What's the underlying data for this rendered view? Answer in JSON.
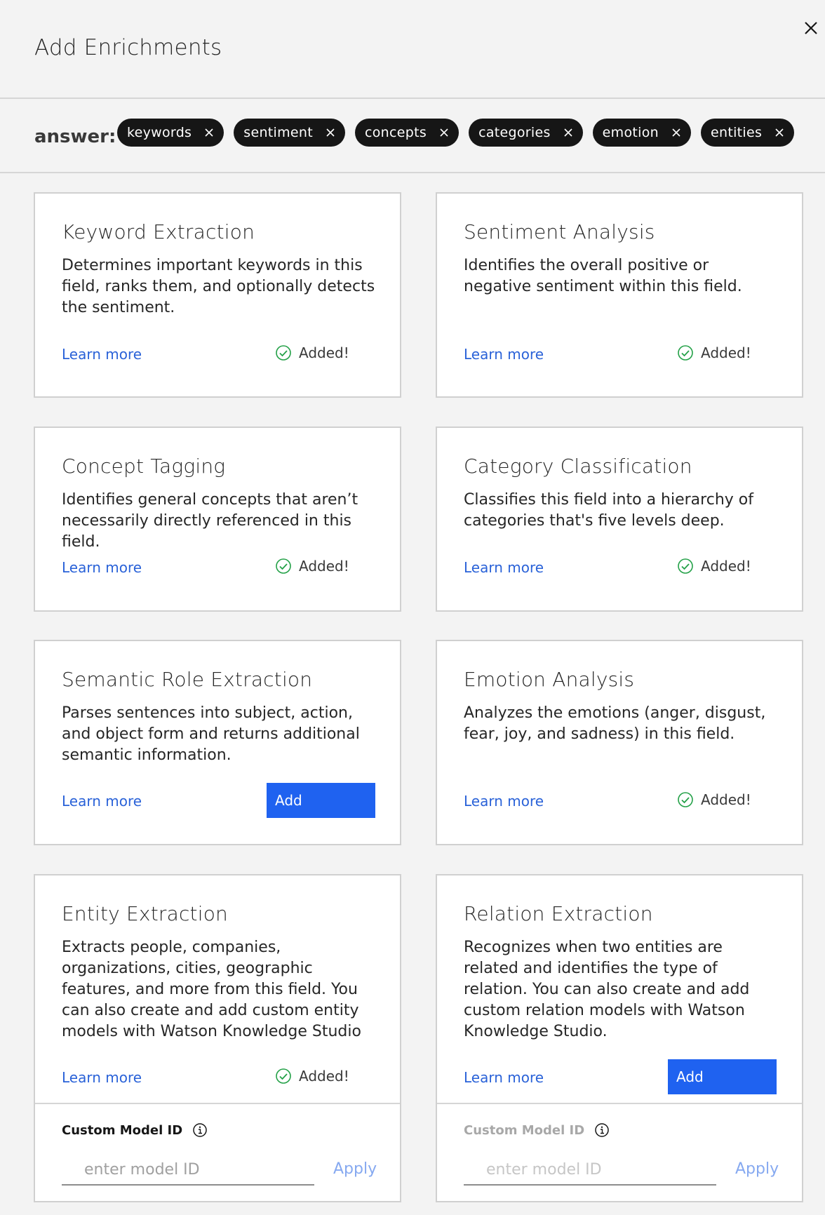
{
  "dialog": {
    "title": "Add Enrichments",
    "close_icon": "close-icon"
  },
  "field": {
    "label": "answer:",
    "tags": [
      {
        "label": "keywords"
      },
      {
        "label": "sentiment"
      },
      {
        "label": "concepts"
      },
      {
        "label": "categories"
      },
      {
        "label": "emotion"
      },
      {
        "label": "entities"
      }
    ]
  },
  "cards": [
    {
      "title": "Keyword Extraction",
      "description": "Determines important keywords in this field, ranks them, and optionally detects the sentiment.",
      "learn_more": "Learn more",
      "status": "Added!"
    },
    {
      "title": "Sentiment Analysis",
      "description": "Identifies the overall positive or negative sentiment within this field.",
      "learn_more": "Learn more",
      "status": "Added!"
    },
    {
      "title": "Concept Tagging",
      "description": "Identifies general concepts that aren’t necessarily directly referenced in this field.",
      "learn_more": "Learn more",
      "status": "Added!"
    },
    {
      "title": "Category Classification",
      "description": "Classifies this field into a hierarchy of categories that's five levels deep.",
      "learn_more": "Learn more",
      "status": "Added!"
    },
    {
      "title": "Semantic Role Extraction",
      "description": "Parses sentences into subject, action, and object form and returns additional semantic information.",
      "learn_more": "Learn more",
      "add_label": "Add"
    },
    {
      "title": "Emotion Analysis",
      "description": "Analyzes the emotions (anger, disgust, fear, joy, and sadness) in this field.",
      "learn_more": "Learn more",
      "status": "Added!"
    },
    {
      "title": "Entity Extraction",
      "description": "Extracts people, companies, organizations, cities, geographic features, and more from this field. You can also create and add custom entity models with Watson Knowledge Studio",
      "learn_more": "Learn more",
      "status": "Added!",
      "custom_model": {
        "label": "Custom Model ID",
        "placeholder": "enter model ID",
        "apply_label": "Apply",
        "enabled": true
      }
    },
    {
      "title": "Relation Extraction",
      "description": "Recognizes when two entities are related and identifies the type of relation. You can also create and add custom relation models with Watson Knowledge Studio.",
      "learn_more": "Learn more",
      "add_label": "Add",
      "custom_model": {
        "label": "Custom Model ID",
        "placeholder": "enter model ID",
        "apply_label": "Apply",
        "enabled": false
      }
    }
  ],
  "colors": {
    "accent": "#1f62f0",
    "link": "#2a62d8",
    "success": "#24a148",
    "tag_bg": "#161616"
  }
}
